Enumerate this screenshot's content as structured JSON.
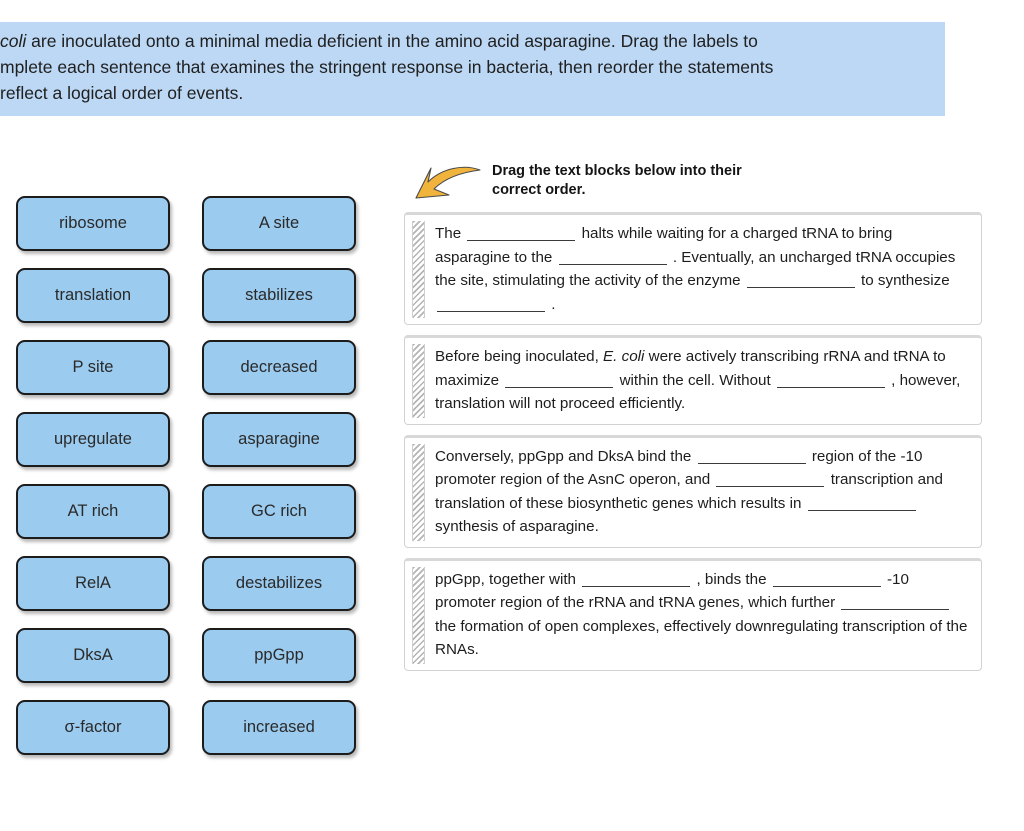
{
  "instruction_banner": {
    "background_color": "#bcd8f5",
    "lines": [
      "coli are inoculated onto a minimal media deficient in the amino acid asparagine. Drag the labels to",
      "mplete each sentence that examines the stringent response in bacteria, then reorder the statements",
      "reflect a logical order of events."
    ],
    "line1_italic": "coli",
    "line1_rest": " are inoculated onto a minimal media deficient in the amino acid asparagine. Drag the labels to",
    "line2": "mplete each sentence that examines the stringent response in bacteria, then reorder the statements",
    "line3": "reflect a logical order of events."
  },
  "label_bank": {
    "tile_color": "#9bcbef",
    "tile_border_color": "#1c1c1c",
    "rows": [
      {
        "left": "ribosome",
        "right": "A site"
      },
      {
        "left": "translation",
        "right": "stabilizes"
      },
      {
        "left": "P site",
        "right": "decreased"
      },
      {
        "left": "upregulate",
        "right": "asparagine"
      },
      {
        "left": "AT rich",
        "right": "GC rich"
      },
      {
        "left": "RelA",
        "right": "destabilizes"
      },
      {
        "left": "DksA",
        "right": "ppGpp"
      },
      {
        "left": "σ-factor",
        "right": "increased"
      }
    ]
  },
  "order_panel": {
    "arrow_icon": "curved-arrow-down-left-icon",
    "arrow_color": "#f0b43c",
    "header_line1": "Drag the text blocks below into their",
    "header_line2": "correct order.",
    "blocks": [
      {
        "id": "block-1",
        "segments": [
          {
            "type": "text",
            "value": "The "
          },
          {
            "type": "blank"
          },
          {
            "type": "text",
            "value": " halts while waiting for a charged tRNA to bring asparagine to the "
          },
          {
            "type": "blank"
          },
          {
            "type": "text",
            "value": " . Eventually, an uncharged tRNA occupies the site, stimulating the activity of the enzyme "
          },
          {
            "type": "blank"
          },
          {
            "type": "text",
            "value": " to synthesize "
          },
          {
            "type": "blank"
          },
          {
            "type": "text",
            "value": " ."
          }
        ]
      },
      {
        "id": "block-2",
        "segments": [
          {
            "type": "text",
            "value": "Before being inoculated, "
          },
          {
            "type": "italic",
            "value": "E. coli"
          },
          {
            "type": "text",
            "value": " were actively transcribing rRNA and tRNA to maximize "
          },
          {
            "type": "blank"
          },
          {
            "type": "text",
            "value": " within the cell.  Without "
          },
          {
            "type": "blank"
          },
          {
            "type": "text",
            "value": " , however, translation will not proceed efficiently."
          }
        ]
      },
      {
        "id": "block-3",
        "segments": [
          {
            "type": "text",
            "value": "Conversely, ppGpp and DksA bind the "
          },
          {
            "type": "blank"
          },
          {
            "type": "text",
            "value": " region of the -10 promoter region of the AsnC operon, and "
          },
          {
            "type": "blank"
          },
          {
            "type": "text",
            "value": " transcription and translation of these biosynthetic genes which results in "
          },
          {
            "type": "blank"
          },
          {
            "type": "text",
            "value": " synthesis of asparagine."
          }
        ]
      },
      {
        "id": "block-4",
        "segments": [
          {
            "type": "text",
            "value": "ppGpp, together with "
          },
          {
            "type": "blank"
          },
          {
            "type": "text",
            "value": " , binds the "
          },
          {
            "type": "blank"
          },
          {
            "type": "text",
            "value": " -10 promoter region of the rRNA and tRNA genes, which further "
          },
          {
            "type": "blank"
          },
          {
            "type": "text",
            "value": " the formation of open complexes, effectively downregulating transcription of the RNAs."
          }
        ]
      }
    ]
  }
}
